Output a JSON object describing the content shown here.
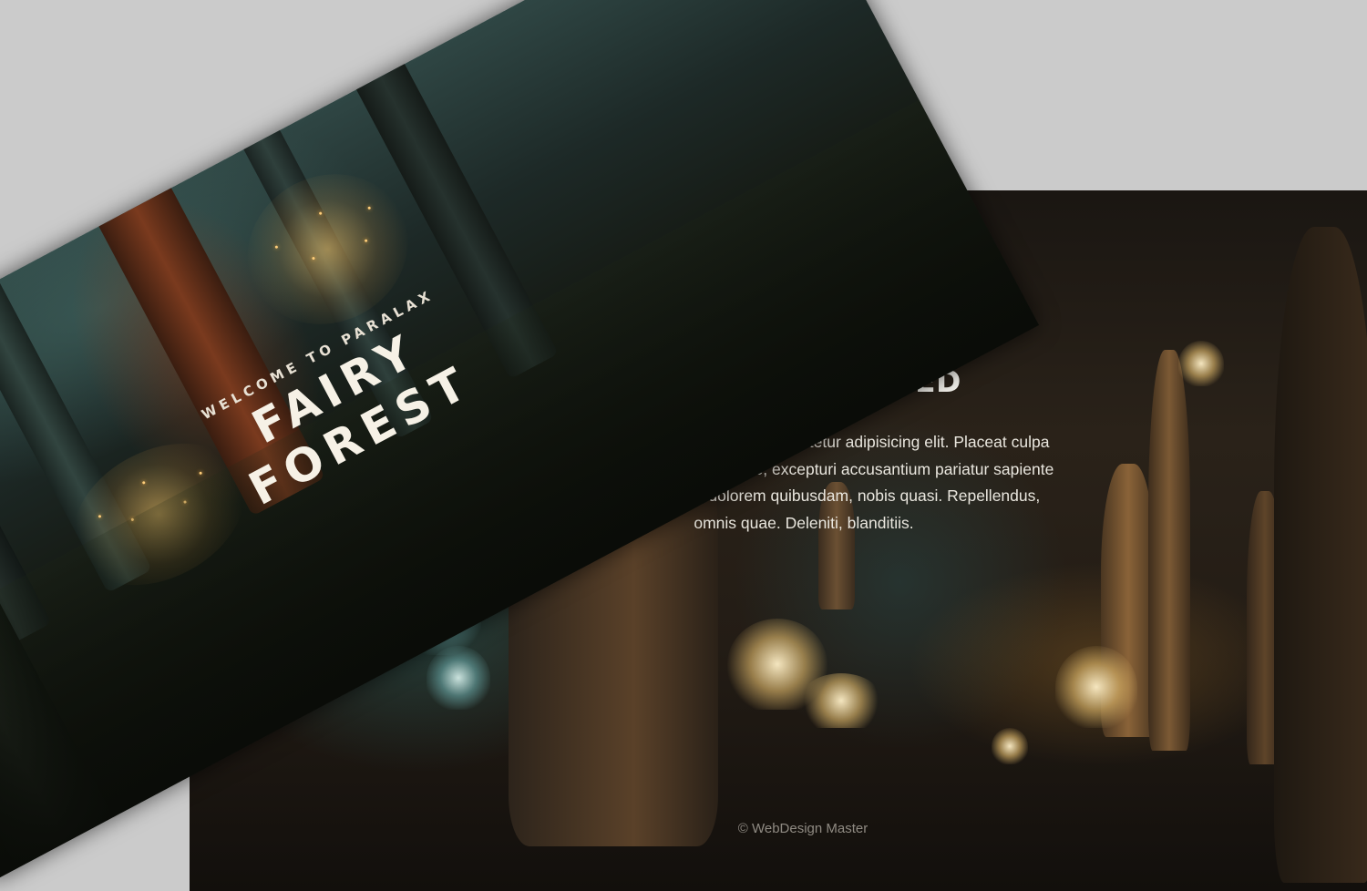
{
  "cave_section": {
    "title": "TO BE CONTINUED",
    "body_lines": [
      "Lorem ipsum dolor, sit amet consectetur adipisicing elit. Placeat culpa",
      "magni cupiditate repudiandae, excepturi accusantium pariatur sapiente",
      "ipsa in itaque ullam dolorem quibusdam, nobis quasi. Repellendus,",
      "omnis quae. Deleniti, blanditiis."
    ],
    "footer": "© WebDesign Master"
  },
  "hero": {
    "subtitle": "WELCOME TO PARALAX",
    "title": "FAIRY FOREST"
  },
  "colors": {
    "backdrop": "#cbcbcb",
    "title_text": "#f2f0ea",
    "footer_text": "#8f8a82",
    "firefly": "#ffce7a"
  }
}
